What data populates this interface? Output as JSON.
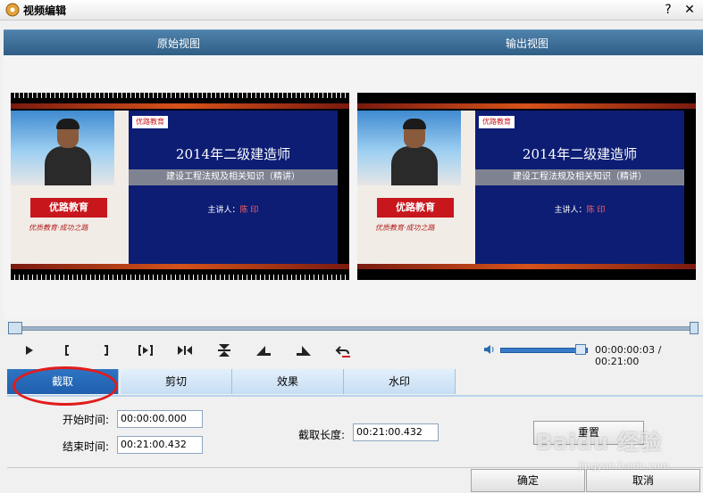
{
  "window": {
    "title": "视频编辑",
    "help_glyph": "?",
    "close_glyph": "✕"
  },
  "views": {
    "original_label": "原始视图",
    "output_label": "输出视图"
  },
  "slide": {
    "brand_small": "优路教育",
    "title": "2014年二级建造师",
    "subtitle": "建设工程法规及相关知识（精讲）",
    "presenter_label": "主讲人：",
    "presenter_name": "陈 印",
    "brand_logo": "优路教育",
    "slogan": "优质教育·成功之路"
  },
  "controls": {
    "play": "▶",
    "mark_in": "[",
    "mark_out": "]",
    "mark_set": "[▶]",
    "step": "▶|◀",
    "icons": [
      "play-icon",
      "mark-in-icon",
      "mark-out-icon",
      "mark-set-icon",
      "frame-step-icon",
      "split-icon",
      "cut-left-icon",
      "cut-right-icon",
      "undo-icon"
    ],
    "volume_level": 0.95,
    "time_display": "00:00:00:03 / 00:21:00"
  },
  "tabs": [
    {
      "label": "截取",
      "active": true
    },
    {
      "label": "剪切",
      "active": false
    },
    {
      "label": "效果",
      "active": false
    },
    {
      "label": "水印",
      "active": false
    }
  ],
  "form": {
    "start_label": "开始时间:",
    "start_value": "00:00:00.000",
    "end_label": "结束时间:",
    "end_value": "00:21:00.432",
    "length_label": "截取长度:",
    "length_value": "00:21:00.432",
    "reset_label": "重置"
  },
  "footer": {
    "ok_label": "确定",
    "cancel_label": "取消"
  },
  "watermark": {
    "text": "Baidu 经验",
    "url": "jingyan.baidu.com"
  },
  "colors": {
    "accent": "#2e74c2",
    "annotation": "#e21b1b",
    "header": "#3b6d96"
  }
}
